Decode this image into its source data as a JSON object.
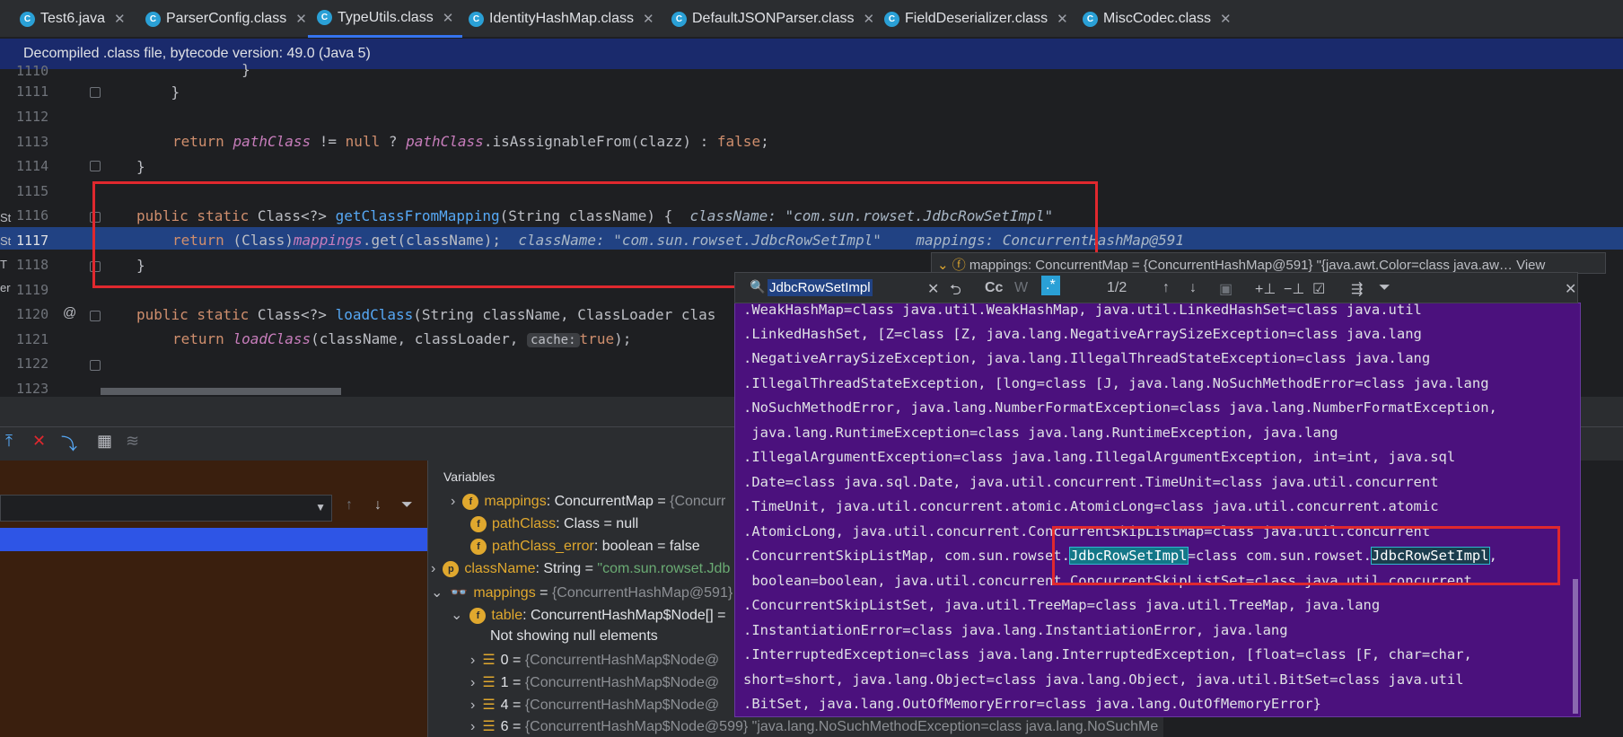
{
  "tabs": [
    {
      "label": "Test6.java"
    },
    {
      "label": "ParserConfig.class"
    },
    {
      "label": "TypeUtils.class"
    },
    {
      "label": "IdentityHashMap.class"
    },
    {
      "label": "DefaultJSONParser.class"
    },
    {
      "label": "FieldDeserializer.class"
    },
    {
      "label": "MiscCodec.class"
    }
  ],
  "active_tab": "TypeUtils.class",
  "banner": "Decompiled .class file, bytecode version: 49.0 (Java 5)",
  "editor": {
    "line_numbers": [
      "1110",
      "1111",
      "1112",
      "1113",
      "1114",
      "1115",
      "1116",
      "1117",
      "1118",
      "1119",
      "1120",
      "1121",
      "1122",
      "1123"
    ],
    "lines": {
      "l1110": "        }",
      "l1111": "    }",
      "l1113_kw": "return",
      "l1113_a": "pathClass",
      "l1113_b": " != ",
      "l1113_null": "null",
      "l1113_c": " ? ",
      "l1113_d": "pathClass",
      "l1113_e": ".isAssignableFrom(clazz) : ",
      "l1113_false": "false",
      "l1113_f": ";",
      "l1114": "}",
      "l1116_kw": "public static",
      "l1116_a": " Class<?> ",
      "l1116_fn": "getClassFromMapping",
      "l1116_b": "(String className) {",
      "l1116_hint": "className: \"com.sun.rowset.JdbcRowSetImpl\"",
      "l1117_kw": "return",
      "l1117_a": " (Class)",
      "l1117_it": "mappings",
      "l1117_b": ".get(className);",
      "l1117_hint1": "className: \"com.sun.rowset.JdbcRowSetImpl\"",
      "l1117_hint2": "mappings: ConcurrentHashMap@591",
      "l1118": "}",
      "l1120_kw": "public static",
      "l1120_a": " Class<?> ",
      "l1120_fn": "loadClass",
      "l1120_b": "(String className, ClassLoader clas",
      "l1121_kw": "return",
      "l1121_it": "loadClass",
      "l1121_a": "(className, classLoader, ",
      "l1121_hint": "cache:",
      "l1121_true": "true",
      "l1121_b": ");"
    }
  },
  "popup_header": "mappings: ConcurrentMap = {ConcurrentHashMap@591} \"{java.awt.Color=class java.aw… View",
  "search": {
    "value": "JdbcRowSetImpl",
    "count": "1/2",
    "cc": "Cc",
    "w": "W",
    "regex": ".*"
  },
  "value_lines": [
    ".WeakHashMap=class java.util.WeakHashMap, java.util.LinkedHashSet=class java.util",
    ".LinkedHashSet, [Z=class [Z, java.lang.NegativeArraySizeException=class java.lang",
    ".NegativeArraySizeException, java.lang.IllegalThreadStateException=class java.lang",
    ".IllegalThreadStateException, [long=class [J, java.lang.NoSuchMethodError=class java.lang",
    ".NoSuchMethodError, java.lang.NumberFormatException=class java.lang.NumberFormatException,",
    " java.lang.RuntimeException=class java.lang.RuntimeException, java.lang",
    ".IllegalArgumentException=class java.lang.IllegalArgumentException, int=int, java.sql",
    ".Date=class java.sql.Date, java.util.concurrent.TimeUnit=class java.util.concurrent",
    ".TimeUnit, java.util.concurrent.atomic.AtomicLong=class java.util.concurrent.atomic",
    ".AtomicLong, java.util.concurrent.ConcurrentSkipListMap=class java.util.concurrent",
    "",
    " boolean=boolean, java.util.concurrent.ConcurrentSkipListSet=class java.util.concurrent",
    ".ConcurrentSkipListSet, java.util.TreeMap=class java.util.TreeMap, java.lang",
    ".InstantiationError=class java.lang.InstantiationError, java.lang",
    ".InterruptedException=class java.lang.InterruptedException, [float=class [F, char=char,",
    "short=short, java.lang.Object=class java.lang.Object, java.util.BitSet=class java.util",
    ".BitSet, java.lang.OutOfMemoryError=class java.lang.OutOfMemoryError}"
  ],
  "match_line": {
    "a": ".ConcurrentSkipListMap, com.sun.rowset.",
    "m1": "JdbcRowSetImpl",
    "b": "=class com.sun.rowset.",
    "m2": "JdbcRowSetImpl",
    "c": ","
  },
  "variables_header": "Variables",
  "variables": [
    {
      "name": "mappings",
      "type": ": ConcurrentMap",
      "eq": " = ",
      "val": "{Concurr"
    },
    {
      "name": "pathClass",
      "type": ": Class",
      "eq": " = ",
      "val": "null"
    },
    {
      "name": "pathClass_error",
      "type": ": boolean",
      "eq": " = ",
      "val": "false"
    },
    {
      "name": "className",
      "type": ": String",
      "eq": " = ",
      "val": "\"com.sun.rowset.Jdb"
    },
    {
      "name": "mappings",
      "type": "",
      "eq": " = ",
      "val": "{ConcurrentHashMap@591}"
    },
    {
      "name": "table",
      "type": ": ConcurrentHashMap$Node[]",
      "eq": " = ",
      "val": ""
    },
    {
      "name": "Not showing null elements",
      "type": "",
      "eq": "",
      "val": ""
    },
    {
      "name": "0",
      "type": "",
      "eq": " = ",
      "val": "{ConcurrentHashMap$Node@"
    },
    {
      "name": "1",
      "type": "",
      "eq": " = ",
      "val": "{ConcurrentHashMap$Node@"
    },
    {
      "name": "4",
      "type": "",
      "eq": " = ",
      "val": "{ConcurrentHashMap$Node@"
    },
    {
      "name": "6",
      "type": "",
      "eq": " = ",
      "val": "{ConcurrentHashMap$Node@599} \"java.lang.NoSuchMethodException=class java.lang.NoSuchMe"
    }
  ],
  "gutter_marker": "@",
  "side_letters": [
    "St",
    "St",
    "T",
    "er"
  ],
  "colors": {
    "accent": "#3574f0",
    "highlight_box": "#e0282e",
    "popup_bg": "#4b117d",
    "selected_row": "#214283"
  }
}
